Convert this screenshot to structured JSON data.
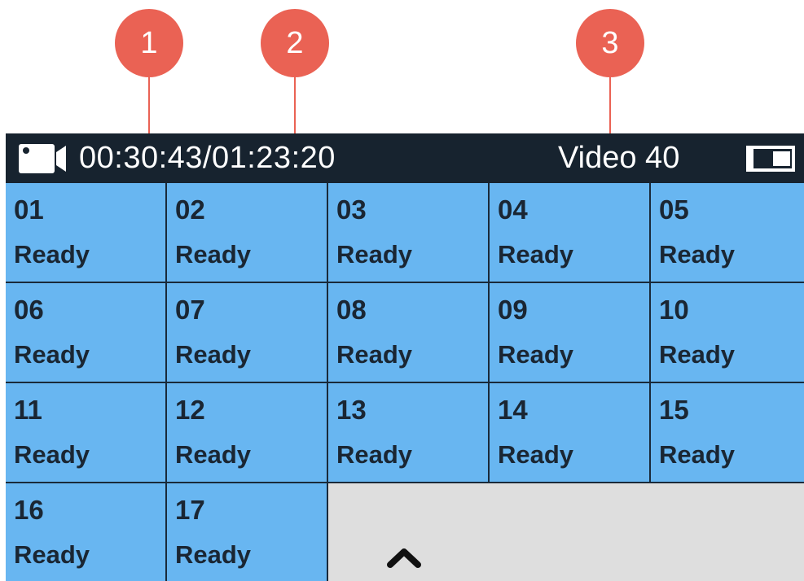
{
  "callouts": [
    "1",
    "2",
    "3"
  ],
  "statusbar": {
    "camera_icon": "video-camera-icon",
    "timecode": "00:30:43/01:23:20",
    "video_label": "Video 40",
    "battery_icon": "battery-icon"
  },
  "slots": [
    {
      "num": "01",
      "status": "Ready"
    },
    {
      "num": "02",
      "status": "Ready"
    },
    {
      "num": "03",
      "status": "Ready"
    },
    {
      "num": "04",
      "status": "Ready"
    },
    {
      "num": "05",
      "status": "Ready"
    },
    {
      "num": "06",
      "status": "Ready"
    },
    {
      "num": "07",
      "status": "Ready"
    },
    {
      "num": "08",
      "status": "Ready"
    },
    {
      "num": "09",
      "status": "Ready"
    },
    {
      "num": "10",
      "status": "Ready"
    },
    {
      "num": "11",
      "status": "Ready"
    },
    {
      "num": "12",
      "status": "Ready"
    },
    {
      "num": "13",
      "status": "Ready"
    },
    {
      "num": "14",
      "status": "Ready"
    },
    {
      "num": "15",
      "status": "Ready"
    },
    {
      "num": "16",
      "status": "Ready"
    },
    {
      "num": "17",
      "status": "Ready"
    }
  ],
  "scroll_icon": "chevron-up-icon",
  "colors": {
    "callout": "#ea6254",
    "statusbar": "#17232f",
    "slot": "#68b6f1",
    "empty": "#dedede"
  }
}
